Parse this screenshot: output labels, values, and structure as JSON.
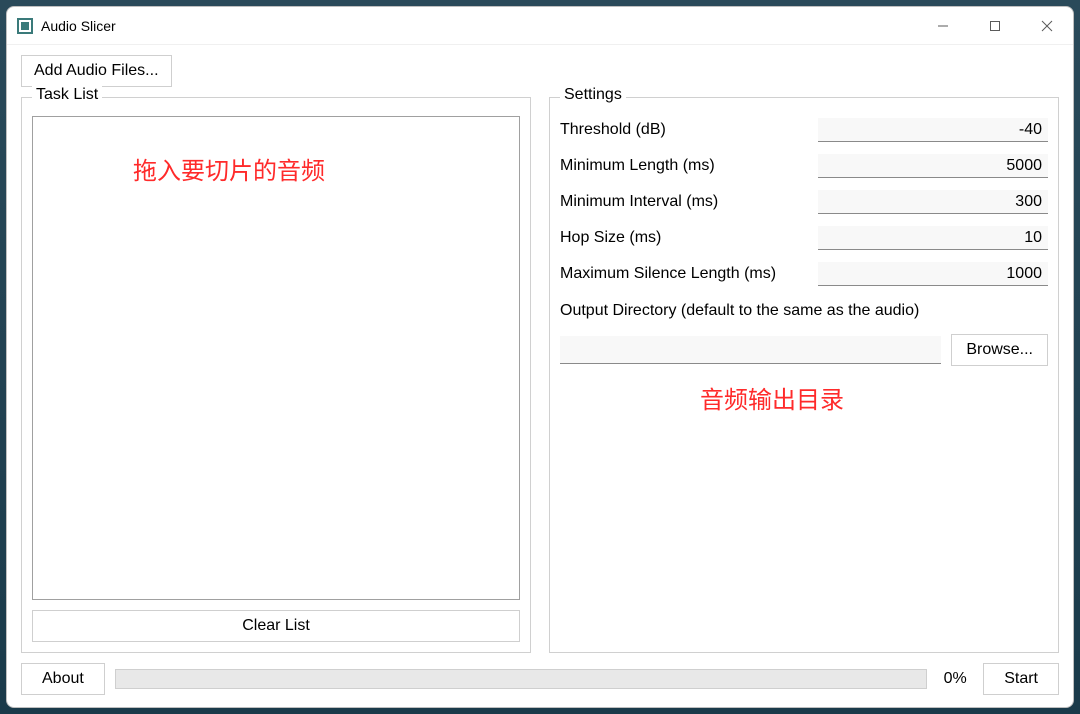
{
  "window": {
    "title": "Audio Slicer"
  },
  "buttons": {
    "add_audio": "Add Audio Files...",
    "clear_list": "Clear List",
    "browse": "Browse...",
    "about": "About",
    "start": "Start"
  },
  "groups": {
    "task_list": "Task List",
    "settings": "Settings"
  },
  "annotations": {
    "drop_hint": "拖入要切片的音频",
    "output_hint": "音频输出目录"
  },
  "settings": {
    "threshold": {
      "label": "Threshold (dB)",
      "value": "-40"
    },
    "min_length": {
      "label": "Minimum Length (ms)",
      "value": "5000"
    },
    "min_interval": {
      "label": "Minimum Interval (ms)",
      "value": "300"
    },
    "hop_size": {
      "label": "Hop Size (ms)",
      "value": "10"
    },
    "max_silence": {
      "label": "Maximum Silence Length (ms)",
      "value": "1000"
    },
    "output_dir_label": "Output Directory (default to the same as the audio)",
    "output_dir_value": ""
  },
  "progress": {
    "percent_text": "0%",
    "percent_value": 0
  }
}
